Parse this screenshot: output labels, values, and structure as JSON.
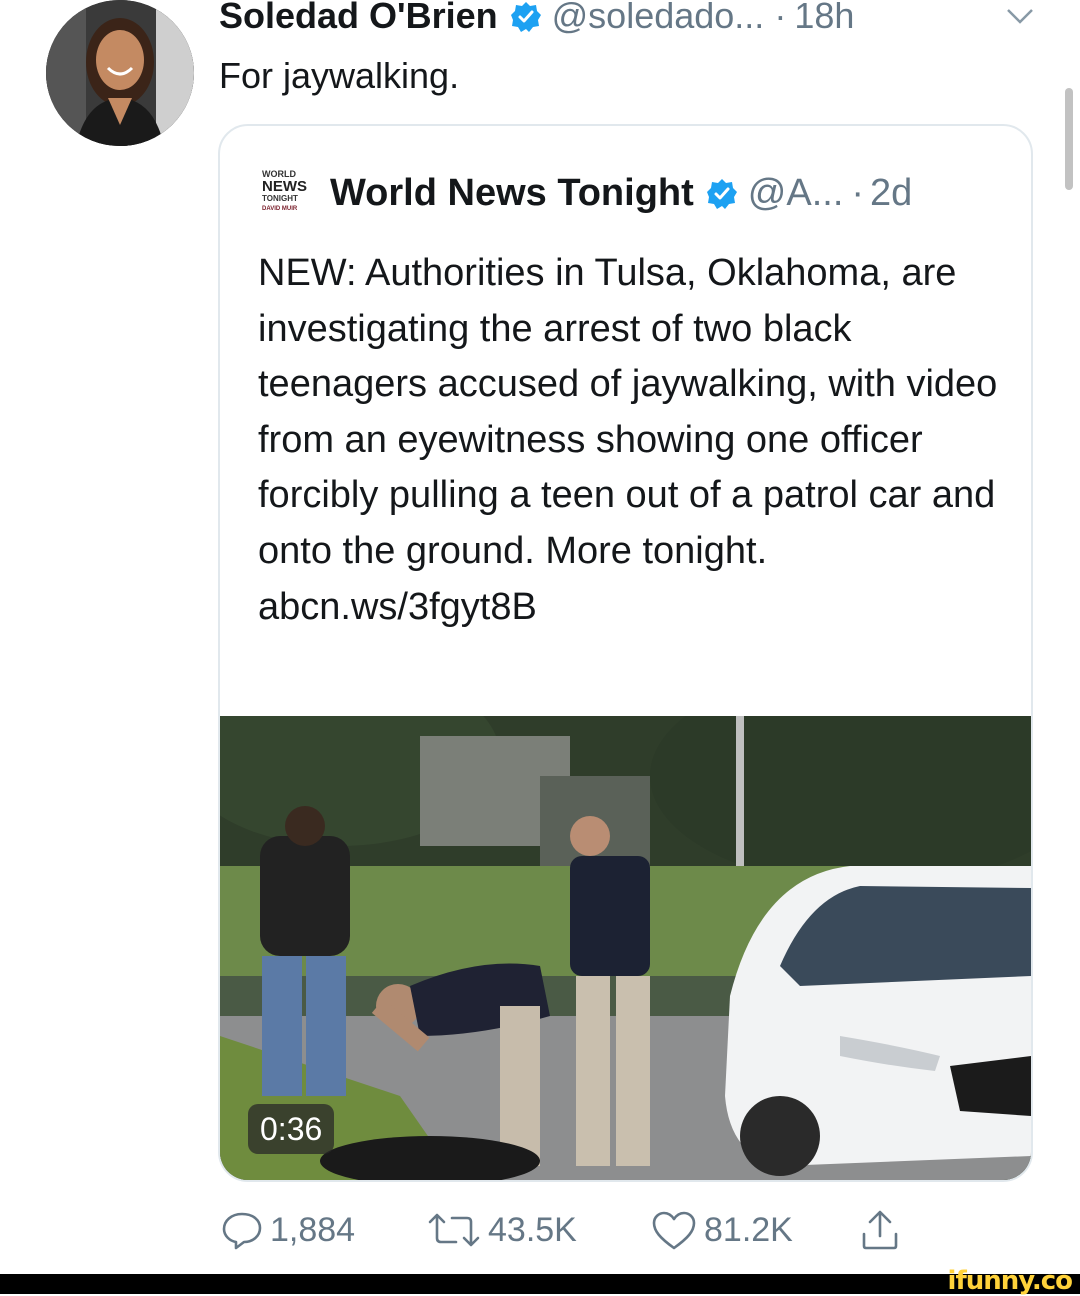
{
  "tweet": {
    "author_name": "Soledad O'Brien",
    "handle": "@soledado...",
    "separator": "·",
    "time": "18h",
    "text": "For jaywalking."
  },
  "quote": {
    "author_name": "World News Tonight",
    "handle": "@A...",
    "separator": "·",
    "time": "2d",
    "logo_text": [
      "WORLD",
      "NEWS",
      "TONIGHT",
      "DAVID MUIR"
    ],
    "text": "NEW: Authorities in Tulsa, Oklahoma, are investigating the arrest of two black teenagers accused of jaywalking, with video from an eyewitness showing one officer forcibly pulling a teen out of a patrol car and onto the ground. More tonight. abcn.ws/3fgyt8B",
    "video_duration": "0:36"
  },
  "actions": {
    "replies": "1,884",
    "retweets": "43.5K",
    "likes": "81.2K"
  },
  "watermark": "ifunny.co",
  "colors": {
    "verified": "#1da1f2",
    "secondary_text": "#657786",
    "border": "#e1e8ed",
    "watermark": "#ffd23a"
  },
  "icons": [
    "verified-badge-icon",
    "chevron-down-icon",
    "reply-icon",
    "retweet-icon",
    "like-icon",
    "share-icon"
  ]
}
